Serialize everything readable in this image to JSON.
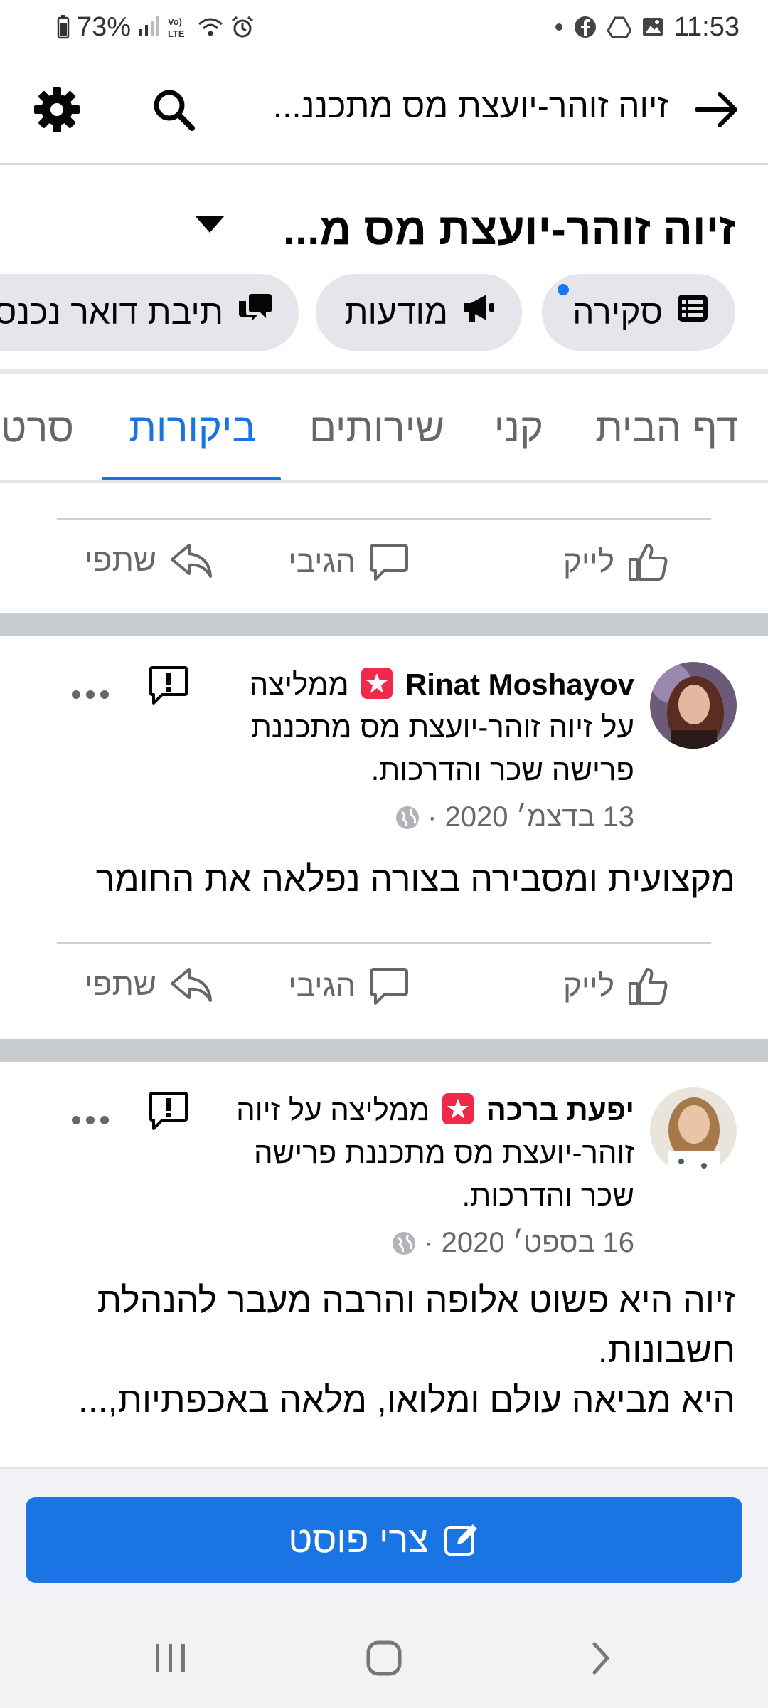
{
  "status_bar": {
    "battery": "73%",
    "time": "11:53",
    "icons": [
      "battery-icon",
      "signal-icon",
      "volte-icon",
      "wifi-icon",
      "alarm-icon",
      "dot-icon",
      "facebook-icon",
      "drive-icon",
      "gallery-icon"
    ]
  },
  "appbar": {
    "title": "זיוה זוהר-יועצת מס מתכננ...",
    "icons": [
      "back-arrow-icon",
      "search-icon",
      "gear-icon"
    ]
  },
  "page_header": {
    "name": "זיוה זוהר-יועצת מס מ...",
    "chips": [
      {
        "label": "סקירה",
        "icon": "list-icon"
      },
      {
        "label": "מודעות",
        "icon": "megaphone-icon"
      },
      {
        "label": "תיבת דואר נכנס",
        "icon": "chat-icon"
      }
    ]
  },
  "tabs": [
    "דף הבית",
    "קני",
    "שירותים",
    "ביקורות",
    "סרט"
  ],
  "active_tab": "ביקורות",
  "actions": {
    "like": "לייק",
    "comment": "הגיבי",
    "share": "שתפי"
  },
  "reviews": [
    {
      "author": "Rinat Moshayov",
      "recommends_text": "ממליצה על",
      "page_line": "זיוה זוהר-יועצת מס מתכננת פרישה שכר והדרכות.",
      "date": "13 בדצמ׳ 2020 ·",
      "body": "מקצועית ומסבירה בצורה נפלאה את החומר"
    },
    {
      "author": "יפעת ברכה",
      "recommends_text": "ממליצה על",
      "page_line": "זיוה זוהר-יועצת מס מתכננת פרישה שכר והדרכות.",
      "date": "16 בספט׳ 2020 ·",
      "body_lines": [
        "זיוה היא פשוט אלופה והרבה מעבר להנהלת חשבונות.",
        "היא מביאה עולם ומלואו, מלאה באכפתיות,..."
      ]
    }
  ],
  "create_post": {
    "label": "צרי פוסט"
  },
  "colors": {
    "accent": "#1b74e4",
    "badge": "#f0284a",
    "muted": "#65676b",
    "chip_bg": "#e4e6eb"
  }
}
